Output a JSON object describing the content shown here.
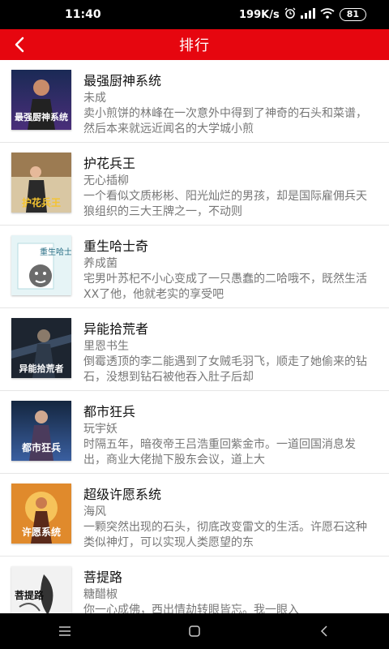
{
  "status_bar": {
    "time": "11:40",
    "network_speed": "199K/s",
    "battery": "81",
    "icons": [
      "alarm-icon",
      "signal-icon",
      "wifi-icon",
      "battery-icon"
    ]
  },
  "header": {
    "title": "排行",
    "back_icon": "back-chevron-icon",
    "background": "#e6060f"
  },
  "books": [
    {
      "title": "最强厨神系统",
      "author": "未成",
      "description": "卖小煎饼的林峰在一次意外中得到了神奇的石头和菜谱，然后本来就远近闻名的大学城小煎",
      "cover_text": "最强厨神系统"
    },
    {
      "title": "护花兵王",
      "author": "无心插柳",
      "description": "一个看似文质彬彬、阳光灿烂的男孩，却是国际雇佣兵天狼组织的三大王牌之一，不动则",
      "cover_text": "护花兵王"
    },
    {
      "title": "重生哈士奇",
      "author": "养成菌",
      "description": "宅男叶苏杞不小心变成了一只愚蠢的二哈哦不，既然生活XX了他，他就老实的享受吧",
      "cover_text": "重生哈士奇"
    },
    {
      "title": "异能拾荒者",
      "author": "里恩书生",
      "description": "倒霉透顶的李二能遇到了女贼毛羽飞，顺走了她偷来的钻石，没想到钻石被他吞入肚子后却",
      "cover_text": "异能拾荒者"
    },
    {
      "title": "都市狂兵",
      "author": "玩宇妖",
      "description": "时隔五年，暗夜帝王吕浩重回紫金市。一道回国消息发出，商业大佬抛下股东会议，道上大",
      "cover_text": "都市狂兵"
    },
    {
      "title": "超级许愿系统",
      "author": "海风",
      "description": "一颗突然出现的石头，彻底改变雷文的生活。许愿石这种类似神灯，可以实现人类愿望的东",
      "cover_text": "许愿系统"
    },
    {
      "title": "菩提路",
      "author": "糖醋椒",
      "description": "你一心成佛，西出情劫转眼皆忘。我一眼入",
      "cover_text": "菩提路"
    }
  ],
  "nav_bar": {
    "icons": [
      "menu-icon",
      "home-icon",
      "back-icon"
    ]
  }
}
